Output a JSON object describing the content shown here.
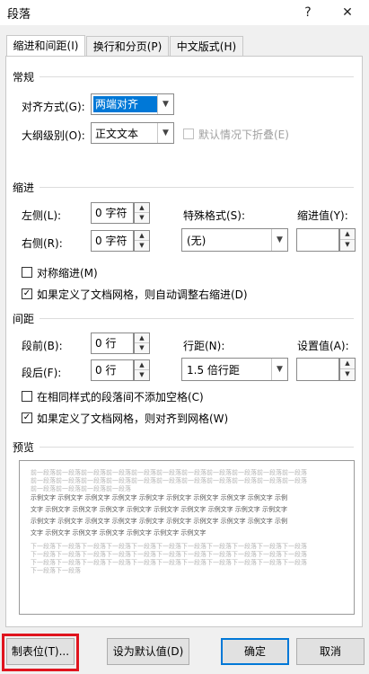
{
  "window": {
    "title": "段落",
    "help": "?",
    "close": "✕"
  },
  "tabs": [
    "缩进和间距(I)",
    "换行和分页(P)",
    "中文版式(H)"
  ],
  "general": {
    "heading": "常规",
    "align_label": "对齐方式(G):",
    "align_value": "两端对齐",
    "outline_label": "大纲级别(O):",
    "outline_value": "正文文本",
    "collapse_label": "默认情况下折叠(E)"
  },
  "indent": {
    "heading": "缩进",
    "left_label": "左侧(L):",
    "left_value": "0 字符",
    "right_label": "右侧(R):",
    "right_value": "0 字符",
    "special_label": "特殊格式(S):",
    "special_value": "(无)",
    "by_label": "缩进值(Y):",
    "by_value": "",
    "mirror_label": "对称缩进(M)",
    "mirror_checked": false,
    "auto_adjust_label": "如果定义了文档网格，则自动调整右缩进(D)",
    "auto_adjust_checked": true
  },
  "spacing": {
    "heading": "间距",
    "before_label": "段前(B):",
    "before_value": "0 行",
    "after_label": "段后(F):",
    "after_value": "0 行",
    "line_label": "行距(N):",
    "line_value": "1.5 倍行距",
    "at_label": "设置值(A):",
    "at_value": "",
    "no_space_label": "在相同样式的段落间不添加空格(C)",
    "no_space_checked": false,
    "snap_grid_label": "如果定义了文档网格，则对齐到网格(W)",
    "snap_grid_checked": true
  },
  "preview": {
    "heading": "预览",
    "prev_lines": [
      "前一段落前一段落前一段落前一段落前一段落前一段落前一段落前一段落前一段落前一段落前一段落",
      "前一段落前一段落前一段落前一段落前一段落前一段落前一段落前一段落前一段落前一段落前一段落",
      "前一段落前一段落前一段落前一段落"
    ],
    "sample_lines": [
      "示例文字 示例文字 示例文字 示例文字 示例文字 示例文字 示例文字 示例文字 示例文字 示例",
      "文字 示例文字 示例文字 示例文字 示例文字 示例文字 示例文字 示例文字 示例文字 示例文字",
      "示例文字 示例文字 示例文字 示例文字 示例文字 示例文字 示例文字 示例文字 示例文字 示例",
      "文字 示例文字 示例文字 示例文字 示例文字 示例文字 示例文字"
    ],
    "next_lines": [
      "下一段落下一段落下一段落下一段落下一段落下一段落下一段落下一段落下一段落下一段落下一段落",
      "下一段落下一段落下一段落下一段落下一段落下一段落下一段落下一段落下一段落下一段落下一段落",
      "下一段落下一段落下一段落下一段落下一段落下一段落下一段落下一段落下一段落下一段落下一段落",
      "下一段落下一段落"
    ]
  },
  "buttons": {
    "tabs": "制表位(T)...",
    "set_default": "设为默认值(D)",
    "ok": "确定",
    "cancel": "取消"
  },
  "colors": {
    "selection": "#0078d7",
    "highlight_box": "#e0141e"
  }
}
